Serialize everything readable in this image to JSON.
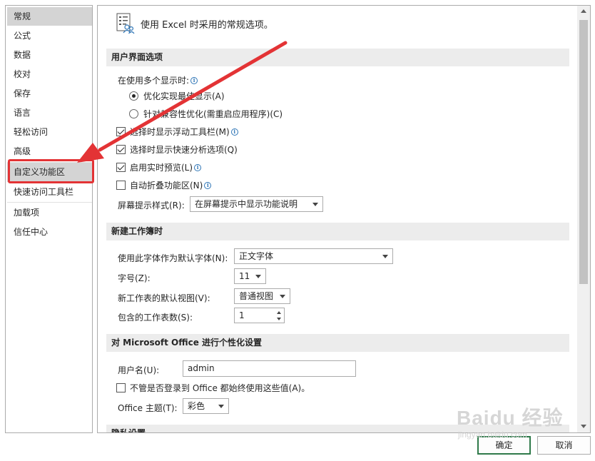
{
  "nav": {
    "items": [
      {
        "label": "常规",
        "selected": true
      },
      {
        "label": "公式"
      },
      {
        "label": "数据"
      },
      {
        "label": "校对"
      },
      {
        "label": "保存"
      },
      {
        "label": "语言"
      },
      {
        "label": "轻松访问"
      },
      {
        "label": "高级"
      },
      {
        "label": "自定义功能区"
      },
      {
        "label": "快速访问工具栏"
      },
      {
        "label": "加载项"
      },
      {
        "label": "信任中心"
      }
    ]
  },
  "header": {
    "description": "使用 Excel 时采用的常规选项。",
    "icon": "general-options-icon"
  },
  "ui_options": {
    "title": "用户界面选项",
    "multi_display_label": "在使用多个显示时:",
    "radio_optimize_appearance": "优化实现最佳显示(A)",
    "radio_optimize_compat": "针对兼容性优化(需重启应用程序)(C)",
    "show_mini_toolbar": "选择时显示浮动工具栏(M)",
    "show_quick_analysis": "选择时显示快速分析选项(Q)",
    "enable_live_preview": "启用实时预览(L)",
    "auto_collapse_ribbon": "自动折叠功能区(N)",
    "screentip_label": "屏幕提示样式(R):",
    "screentip_value": "在屏幕提示中显示功能说明"
  },
  "new_workbook": {
    "title": "新建工作簿时",
    "font_label": "使用此字体作为默认字体(N):",
    "font_value": "正文字体",
    "size_label": "字号(Z):",
    "size_value": "11",
    "view_label": "新工作表的默认视图(V):",
    "view_value": "普通视图",
    "sheets_label": "包含的工作表数(S):",
    "sheets_value": "1"
  },
  "personalize": {
    "title": "对 Microsoft Office 进行个性化设置",
    "username_label": "用户名(U):",
    "username_value": "admin",
    "always_use_label": "不管是否登录到 Office 都始终使用这些值(A)。",
    "theme_label": "Office 主题(T):",
    "theme_value": "彩色"
  },
  "privacy": {
    "title": "隐私设置"
  },
  "buttons": {
    "ok": "确定",
    "cancel": "取消"
  },
  "watermark": {
    "brand": "Baidu 经验",
    "url": "jingyan.baidu.com"
  },
  "colors": {
    "annotation_red": "#e33335",
    "default_button_border": "#2f7a4a",
    "nav_selected": "#d4d4d4",
    "section_header": "#ececec"
  }
}
